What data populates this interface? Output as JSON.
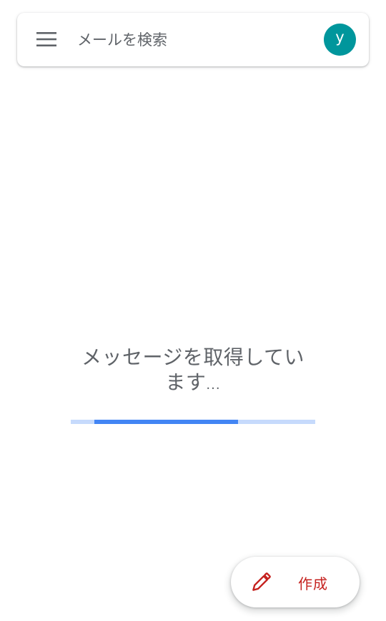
{
  "search": {
    "placeholder": "メールを検索"
  },
  "account": {
    "initial": "y"
  },
  "loading": {
    "message_line1": "メッセージを取得してい",
    "message_line2": "ます",
    "ellipsis": "...",
    "progress_start": 0.096,
    "progress_end": 0.684
  },
  "compose": {
    "label": "作成"
  },
  "icons": {
    "menu": "menu-icon",
    "compose": "pencil-icon"
  },
  "colors": {
    "avatar": "#00969c",
    "progress_fill": "#4285f4",
    "progress_track": "#c6dafc",
    "compose_accent": "#c5221f",
    "text_secondary": "#5f6368"
  }
}
